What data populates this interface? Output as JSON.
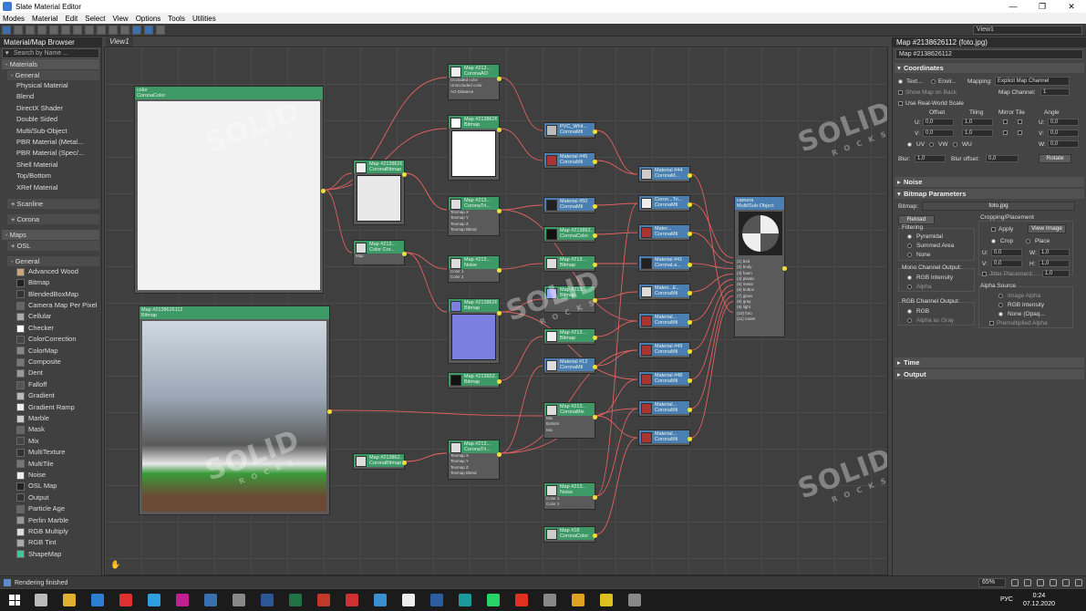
{
  "window": {
    "title": "Slate Material Editor",
    "controls": [
      "—",
      "❐",
      "✕"
    ]
  },
  "menu": [
    "Modes",
    "Material",
    "Edit",
    "Select",
    "View",
    "Options",
    "Tools",
    "Utilities"
  ],
  "toolbar": {
    "view_select": "View1"
  },
  "browser": {
    "title": "Material/Map Browser",
    "search_placeholder": "Search by Name ...",
    "materials_group": "- Materials",
    "general_group": "- General",
    "materials": [
      "Physical Material",
      "Blend",
      "DirectX Shader",
      "Double Sided",
      "Multi/Sub-Object",
      "PBR Material (Metal...",
      "PBR Material (Spec/...",
      "Shell Material",
      "Top/Bottom",
      "XRef Material"
    ],
    "scanline_group": "+ Scanline",
    "corona_group": "+ Corona",
    "maps_group": "- Maps",
    "osl_group": "+ OSL",
    "maps_general_group": "- General",
    "maps": [
      "Advanced Wood",
      "Bitmap",
      "BlendedBoxMap",
      "Camera Map Per Pixel",
      "Cellular",
      "Checker",
      "ColorCorrection",
      "ColorMap",
      "Composite",
      "Dent",
      "Falloff",
      "Gradient",
      "Gradient Ramp",
      "Marble",
      "Mask",
      "Mix",
      "MultiTexture",
      "MultiTile",
      "Noise",
      "OSL Map",
      "Output",
      "Particle Age",
      "Perlin Marble",
      "RGB Multiply",
      "RGB Tint",
      "ShapeMap"
    ]
  },
  "view_tab": "View1",
  "nodes": {
    "color_node": {
      "title": "color",
      "sub": "CoronaColor"
    },
    "bitmap_preview": {
      "title": "Map #2138626112",
      "sub": "Bitmap"
    },
    "n_bitmap_101": {
      "title": "Map #2138626101",
      "sub": "CoronaBitmap"
    },
    "n_colorcor": {
      "title": "Map #213...",
      "sub": "Color Cor..."
    },
    "n_coronaao": {
      "title": "Map #213...",
      "sub": "CoronaAO"
    },
    "n_bitmap_103": {
      "title": "Map #2138626103",
      "sub": "Bitmap"
    },
    "n_triplanar1": {
      "title": "Map #213...",
      "sub": "CoronaTri..."
    },
    "n_noise1": {
      "title": "Map #213...",
      "sub": "Noise"
    },
    "n_bitmap_109": {
      "title": "Map #2138626109",
      "sub": "Bitmap"
    },
    "n_bitmap_small": {
      "title": "Map #213652...",
      "sub": "Bitmap"
    },
    "n_coronabitmap2": {
      "title": "Map #213862...",
      "sub": "CoronaBitmap"
    },
    "n_triplanar2": {
      "title": "Map #213...",
      "sub": "CoronaTri..."
    },
    "n_coronamix": {
      "title": "Map #213...",
      "sub": "CoronaMix"
    },
    "n_noise2": {
      "title": "Map #213...",
      "sub": "Noise"
    },
    "n_coronacolor18": {
      "title": "Map #18",
      "sub": "CoronaColor"
    },
    "mat_pvc": {
      "title": "PVC_Whit...",
      "sub": "CoronaMtl"
    },
    "mat_45": {
      "title": "Material #45",
      "sub": "CoronaMtl"
    },
    "mat_50": {
      "title": "Material #50",
      "sub": "CoronaMtl"
    },
    "map_colorc2": {
      "title": "Map #213862...",
      "sub": "CoronaColor"
    },
    "map_bitmap3": {
      "title": "Map #213...",
      "sub": "Bitmap"
    },
    "map_bitmap4": {
      "title": "Map #213...",
      "sub": "Bitmap"
    },
    "map_bitmap5": {
      "title": "Map #213...",
      "sub": "Bitmap"
    },
    "mat_12": {
      "title": "Material #12",
      "sub": "CoronaMtl"
    },
    "mat_44": {
      "title": "Material #44",
      "sub": "CoronaM..."
    },
    "mat_tri": {
      "title": "Coron...Tri...",
      "sub": "CoronaMtl"
    },
    "mat_ad": {
      "title": "Mater...",
      "sub": "CoronaMtl"
    },
    "mat_41": {
      "title": "Material #41",
      "sub": "CoronaLa..."
    },
    "mat_e": {
      "title": "Materi...E...",
      "sub": "CoronaMtl"
    },
    "mat_pl": {
      "title": "Material...",
      "sub": "CoronaMtl"
    },
    "mat_49": {
      "title": "Material #49",
      "sub": "CoronaMtl"
    },
    "mat_48": {
      "title": "Material #48",
      "sub": "CoronaMtl"
    },
    "mat_c": {
      "title": "Material...",
      "sub": "CoronaMtl"
    },
    "mat_d": {
      "title": "Material...",
      "sub": "CoronaMtl"
    },
    "multisub": {
      "title": "camera",
      "sub": "Multi/Sub-Object"
    }
  },
  "props": {
    "header": "Map #2138626112 (foto.jpg)",
    "name_field": "Map #2138626112",
    "coordinates": "Coordinates",
    "texture_label": "Text...",
    "environ_label": "Envir...",
    "mapping_label": "Mapping:",
    "mapping_value": "Explicit Map Channel",
    "show_map_on_back": "Show Map on Back",
    "map_channel_label": "Map Channel:",
    "map_channel_value": "1",
    "real_world": "Use Real-World Scale",
    "offset": "Offset",
    "tiling": "Tiling",
    "mirror_tile": "Mirror Tile",
    "angle": "Angle",
    "u_label": "U:",
    "v_label": "V:",
    "w_label": "W:",
    "u_offset": "0,0",
    "v_offset": "0,0",
    "u_tiling": "1,0",
    "v_tiling": "1,0",
    "u_angle": "0,0",
    "v_angle": "0,0",
    "w_angle": "0,0",
    "uv": "UV",
    "vw": "VW",
    "wu": "WU",
    "blur_label": "Blur:",
    "blur_value": "1,0",
    "blur_offset_label": "Blur offset:",
    "blur_offset_value": "0,0",
    "rotate": "Rotate",
    "noise": "Noise",
    "bitmap_params": "Bitmap Parameters",
    "bitmap_label": "Bitmap:",
    "bitmap_value": "foto.jpg",
    "reload": "Reload",
    "cropping": "Cropping/Placement",
    "apply": "Apply",
    "view_image": "View Image",
    "crop": "Crop",
    "place": "Place",
    "filtering": "Filtering",
    "pyramidal": "Pyramidal",
    "summed_area": "Summed Area",
    "none": "None",
    "cu_label": "U:",
    "cu_value": "0,0",
    "cw_label": "W:",
    "cw_value": "1,0",
    "cv_label": "V:",
    "cv_value": "0,0",
    "ch_label": "H:",
    "ch_value": "1,0",
    "jitter": "Jitter Placement:",
    "jitter_value": "1,0",
    "mono_output": "Mono Channel Output:",
    "rgb_intensity": "RGB Intensity",
    "alpha": "Alpha",
    "rgb_output": "RGB Channel Output:",
    "rgb": "RGB",
    "alpha_as_gray": "Alpha as Gray",
    "alpha_source": "Alpha Source",
    "image_alpha": "Image Alpha",
    "alpha_rgb_intensity": "RGB Intensity",
    "none_opaque": "None (Opaq...",
    "premultiplied": "Premultiplied Alpha",
    "time": "Time",
    "output": "Output"
  },
  "status": {
    "message": "Rendering finished",
    "zoom": "65%"
  },
  "taskbar": {
    "lang": "РУС",
    "time": "0:24",
    "date": "07.12.2020"
  },
  "watermark": {
    "brand": "SOLID",
    "sub": "ROCKS"
  }
}
